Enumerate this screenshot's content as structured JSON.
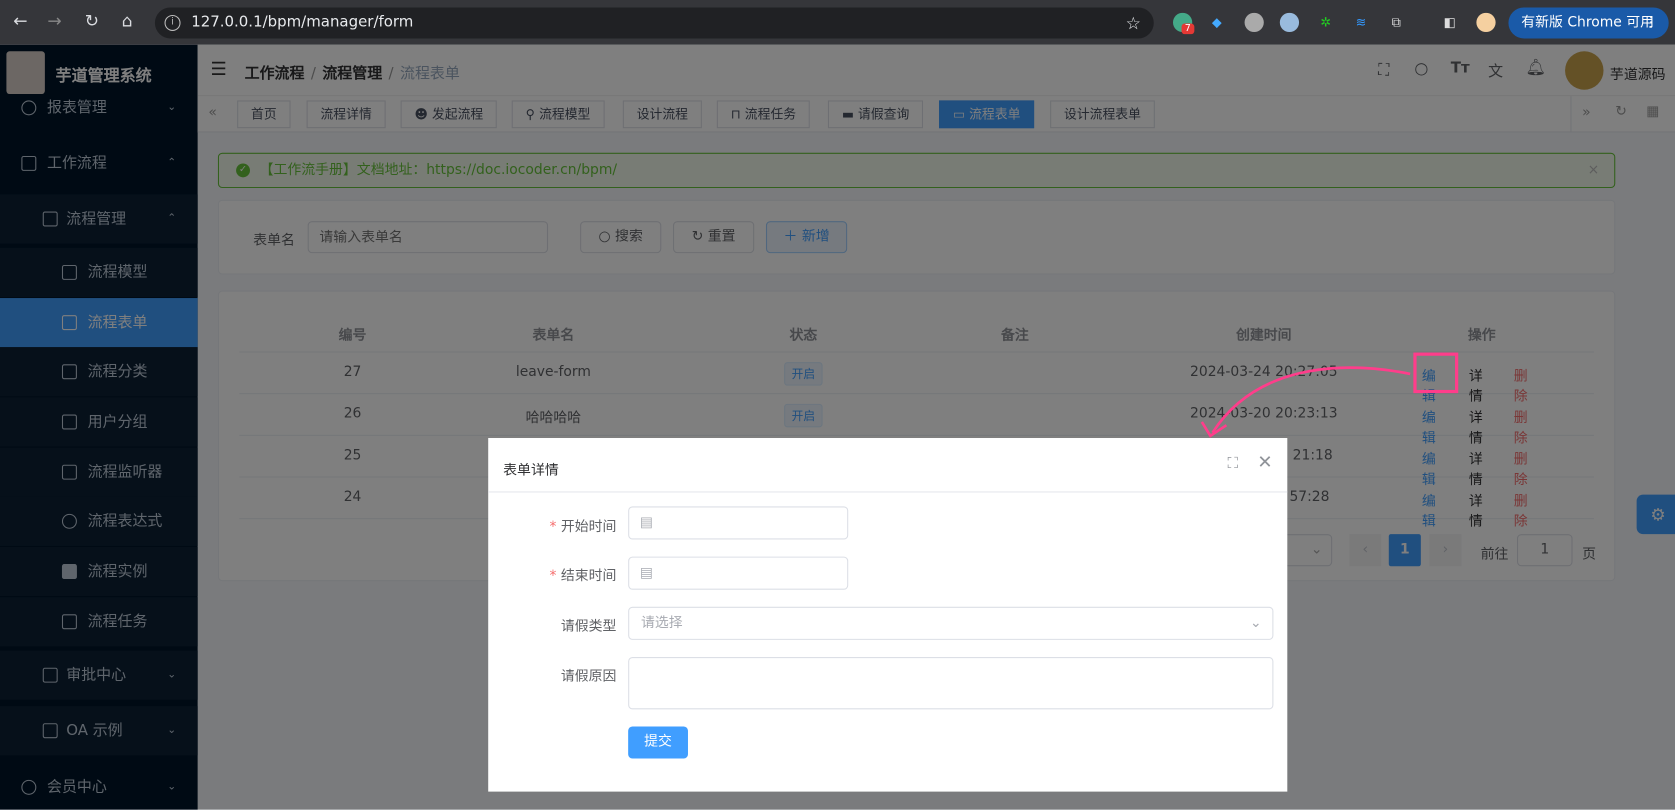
{
  "browser": {
    "url": "127.0.0.1/bpm/manager/form",
    "update_label": "有新版 Chrome 可用",
    "ext_badge": "7"
  },
  "sidebar": {
    "brand": "芋道管理系统",
    "items": [
      {
        "label": "报表管理",
        "icon": "pie-chart-icon"
      },
      {
        "label": "工作流程",
        "icon": "workflow-icon"
      },
      {
        "label": "流程管理",
        "icon": "list-icon"
      },
      {
        "label": "流程模型",
        "icon": "model-icon"
      },
      {
        "label": "流程表单",
        "icon": "form-icon"
      },
      {
        "label": "流程分类",
        "icon": "category-icon"
      },
      {
        "label": "用户分组",
        "icon": "user-group-icon"
      },
      {
        "label": "流程监听器",
        "icon": "listener-icon"
      },
      {
        "label": "流程表达式",
        "icon": "expression-icon"
      },
      {
        "label": "流程实例",
        "icon": "instance-icon"
      },
      {
        "label": "流程任务",
        "icon": "bookmark-icon"
      },
      {
        "label": "审批中心",
        "icon": "approval-icon"
      },
      {
        "label": "OA 示例",
        "icon": "oa-icon"
      },
      {
        "label": "会员中心",
        "icon": "bike-icon"
      }
    ]
  },
  "header": {
    "breadcrumb": [
      "工作流程",
      "流程管理",
      "流程表单"
    ],
    "username": "芋道源码"
  },
  "tabs": [
    "首页",
    "流程详情",
    "发起流程",
    "流程模型",
    "设计流程",
    "流程任务",
    "请假查询",
    "流程表单",
    "设计流程表单"
  ],
  "alert": {
    "text": "【工作流手册】文档地址：https://doc.iocoder.cn/bpm/"
  },
  "search": {
    "label": "表单名",
    "placeholder": "请输入表单名",
    "search_btn": "搜索",
    "reset_btn": "重置",
    "add_btn": "新增"
  },
  "table": {
    "headers": [
      "编号",
      "表单名",
      "状态",
      "备注",
      "创建时间",
      "操作"
    ],
    "rows": [
      {
        "id": "27",
        "name": "leave-form",
        "status": "开启",
        "remark": "",
        "created": "2024-03-24 20:27:05"
      },
      {
        "id": "26",
        "name": "哈哈哈哈",
        "status": "开启",
        "remark": "",
        "created": "2024-03-20 20:23:13"
      },
      {
        "id": "25",
        "name": "",
        "status": "",
        "remark": "",
        "created": "21:18"
      },
      {
        "id": "24",
        "name": "",
        "status": "",
        "remark": "",
        "created": "57:28"
      }
    ],
    "actions": {
      "edit": "编辑",
      "detail": "详情",
      "delete": "删除"
    }
  },
  "pagination": {
    "current": "1",
    "goto_label": "前往",
    "goto_value": "1",
    "page_suffix": "页"
  },
  "modal": {
    "title": "表单详情",
    "fields": [
      {
        "label": "开始时间",
        "required": true,
        "type": "date",
        "value": ""
      },
      {
        "label": "结束时间",
        "required": true,
        "type": "date",
        "value": ""
      },
      {
        "label": "请假类型",
        "required": false,
        "type": "select",
        "placeholder": "请选择"
      },
      {
        "label": "请假原因",
        "required": false,
        "type": "textarea",
        "value": ""
      }
    ],
    "submit": "提交"
  },
  "colors": {
    "primary": "#409eff",
    "danger": "#f56c6c",
    "success": "#67c23a",
    "sidebar": "#001529",
    "annotation": "#ff3d8b"
  }
}
